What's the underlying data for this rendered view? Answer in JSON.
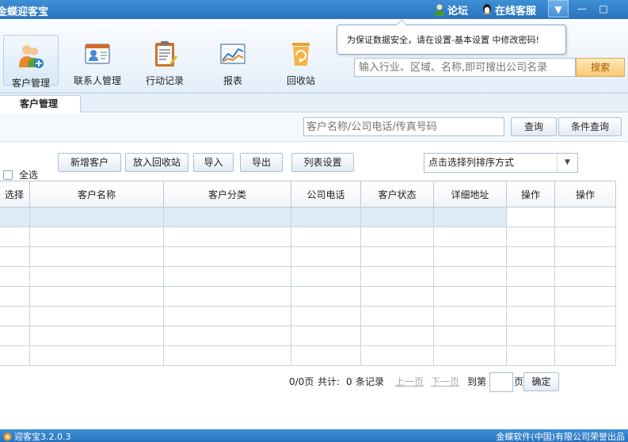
{
  "window": {
    "title": "金蝶迎客宝",
    "forum_label": "论坛",
    "support_label": "在线客服",
    "menu_glyph": "▼",
    "minimize_glyph": "—",
    "maximize_glyph": "□"
  },
  "toolbar": {
    "items": [
      {
        "label": "客户管理",
        "icon": "customer-icon"
      },
      {
        "label": "联系人管理",
        "icon": "contact-card-icon"
      },
      {
        "label": "行动记录",
        "icon": "clipboard-icon"
      },
      {
        "label": "报表",
        "icon": "chart-icon"
      },
      {
        "label": "回收站",
        "icon": "recycle-bin-icon"
      }
    ]
  },
  "notice": "为保证数据安全，请在设置-基本设置 中修改密码!",
  "search": {
    "placeholder": "输入行业、区域、名称,即可搜出公司名录",
    "button": "搜索"
  },
  "tabs": [
    "客户管理"
  ],
  "query": {
    "placeholder": "客户名称/公司电话/传真号码",
    "search_button": "查询",
    "condition_button": "条件查询"
  },
  "actions": {
    "select_all": "全选",
    "add": "新增客户",
    "recycle": "放入回收站",
    "import": "导入",
    "export": "导出",
    "columns": "列表设置",
    "sort_placeholder": "点击选择列排序方式"
  },
  "table": {
    "columns": [
      "选择",
      "客户名称",
      "客户分类",
      "公司电话",
      "客户状态",
      "详细地址",
      "操作",
      "操作"
    ],
    "rows": 8
  },
  "pager": {
    "pages": "0/0页",
    "total_prefix": "共计:",
    "total_count": "0",
    "total_suffix": "条记录",
    "prev": "上一页",
    "next": "下一页",
    "goto": "到第",
    "page_unit": "页",
    "confirm": "确定"
  },
  "status": {
    "version": "迎客宝3.2.0.3",
    "copyright": "金蝶软件(中国)有限公司荣誉出品"
  },
  "colors": {
    "titlebar": "#2a73bd",
    "search_button": "#f8c874",
    "selected_row": "#dfeaf7"
  }
}
